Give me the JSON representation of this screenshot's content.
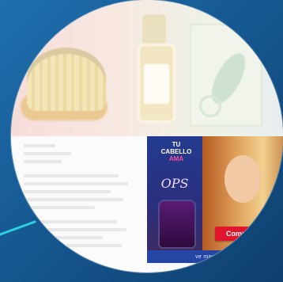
{
  "ad": {
    "title_line1": "TU",
    "title_line2": "CABELLO",
    "title_line3": "AMA",
    "brand": "OPS",
    "button_label": "Compra",
    "footer_text": "ve mas en Mabel"
  },
  "colors": {
    "background": "#14548c",
    "accent_pointer": "#2fd0e0",
    "ad_blue": "#1b3f8f",
    "cta_red": "#e0152e"
  }
}
